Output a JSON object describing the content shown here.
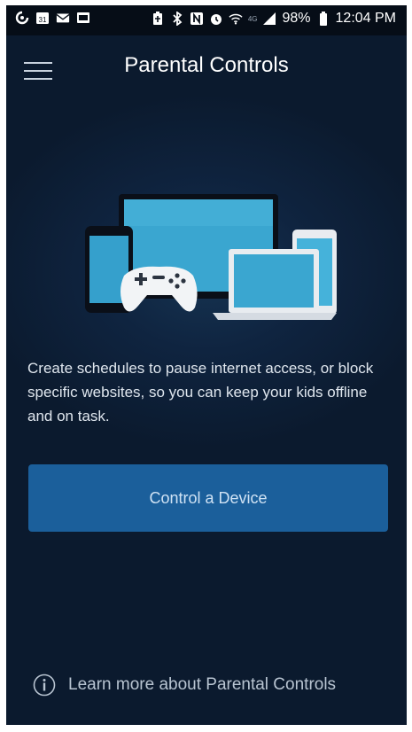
{
  "status_bar": {
    "left_icons": [
      "sync-icon",
      "calendar-icon",
      "mail-icon",
      "photo-icon"
    ],
    "right_icons": [
      "battery-saver-icon",
      "bluetooth-icon",
      "nfc-icon",
      "alarm-icon",
      "wifi-icon",
      "signal-icon",
      "battery-icon"
    ],
    "calendar_day": "31",
    "network_label": "4G",
    "battery": "98%",
    "time": "12:04 PM"
  },
  "header": {
    "title": "Parental Controls",
    "menu_icon": "hamburger-menu-icon"
  },
  "illustration": {
    "devices": [
      "phone",
      "monitor",
      "game-controller",
      "laptop",
      "tablet"
    ]
  },
  "main": {
    "description": "Create schedules to pause internet access, or block specific websites, so you can keep your kids offline and on task.",
    "cta_label": "Control a Device"
  },
  "footer": {
    "learn_more": "Learn more about Parental Controls",
    "icon": "info-icon"
  },
  "colors": {
    "background": "#0b1a2e",
    "button": "#1b5f9b",
    "button_text": "#cfe2f4",
    "text": "#dfe6ee"
  }
}
